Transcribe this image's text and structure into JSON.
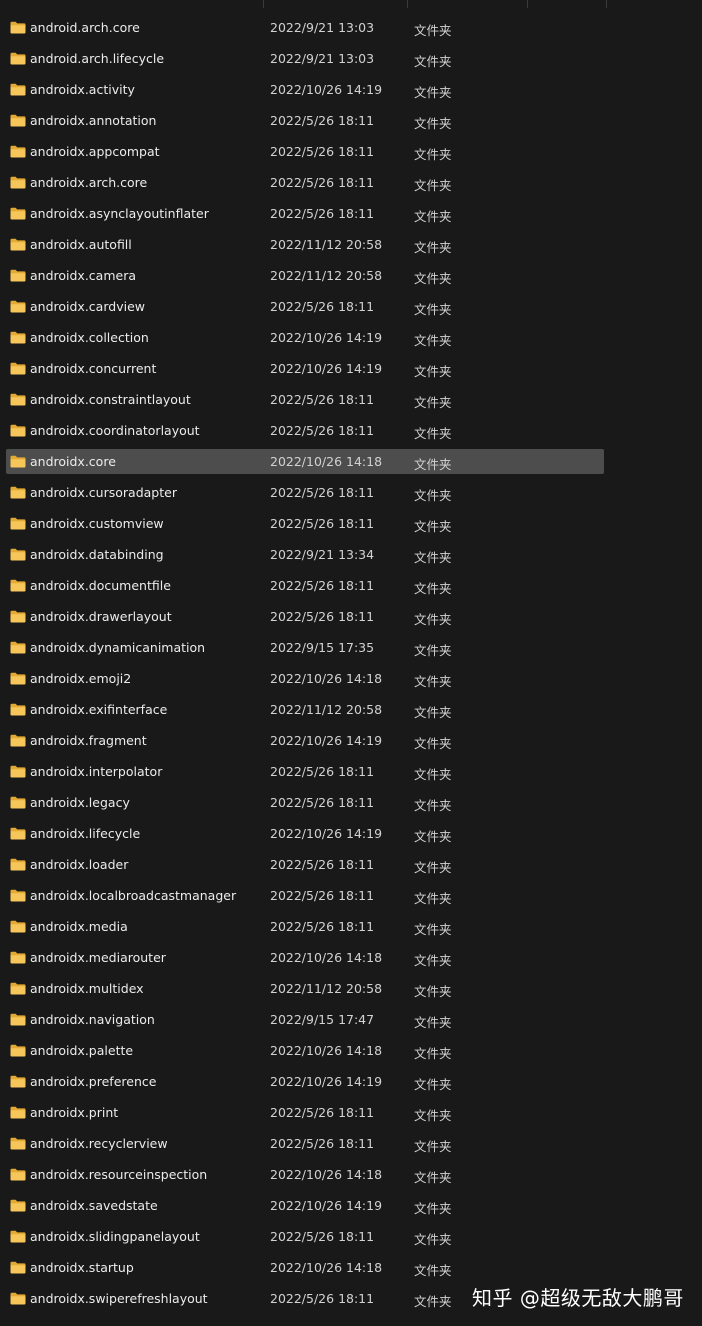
{
  "files": [
    {
      "name": "android.arch.core",
      "date": "2022/9/21 13:03",
      "type": "文件夹",
      "selected": false
    },
    {
      "name": "android.arch.lifecycle",
      "date": "2022/9/21 13:03",
      "type": "文件夹",
      "selected": false
    },
    {
      "name": "androidx.activity",
      "date": "2022/10/26 14:19",
      "type": "文件夹",
      "selected": false
    },
    {
      "name": "androidx.annotation",
      "date": "2022/5/26 18:11",
      "type": "文件夹",
      "selected": false
    },
    {
      "name": "androidx.appcompat",
      "date": "2022/5/26 18:11",
      "type": "文件夹",
      "selected": false
    },
    {
      "name": "androidx.arch.core",
      "date": "2022/5/26 18:11",
      "type": "文件夹",
      "selected": false
    },
    {
      "name": "androidx.asynclayoutinflater",
      "date": "2022/5/26 18:11",
      "type": "文件夹",
      "selected": false
    },
    {
      "name": "androidx.autofill",
      "date": "2022/11/12 20:58",
      "type": "文件夹",
      "selected": false
    },
    {
      "name": "androidx.camera",
      "date": "2022/11/12 20:58",
      "type": "文件夹",
      "selected": false
    },
    {
      "name": "androidx.cardview",
      "date": "2022/5/26 18:11",
      "type": "文件夹",
      "selected": false
    },
    {
      "name": "androidx.collection",
      "date": "2022/10/26 14:19",
      "type": "文件夹",
      "selected": false
    },
    {
      "name": "androidx.concurrent",
      "date": "2022/10/26 14:19",
      "type": "文件夹",
      "selected": false
    },
    {
      "name": "androidx.constraintlayout",
      "date": "2022/5/26 18:11",
      "type": "文件夹",
      "selected": false
    },
    {
      "name": "androidx.coordinatorlayout",
      "date": "2022/5/26 18:11",
      "type": "文件夹",
      "selected": false
    },
    {
      "name": "androidx.core",
      "date": "2022/10/26 14:18",
      "type": "文件夹",
      "selected": true
    },
    {
      "name": "androidx.cursoradapter",
      "date": "2022/5/26 18:11",
      "type": "文件夹",
      "selected": false
    },
    {
      "name": "androidx.customview",
      "date": "2022/5/26 18:11",
      "type": "文件夹",
      "selected": false
    },
    {
      "name": "androidx.databinding",
      "date": "2022/9/21 13:34",
      "type": "文件夹",
      "selected": false
    },
    {
      "name": "androidx.documentfile",
      "date": "2022/5/26 18:11",
      "type": "文件夹",
      "selected": false
    },
    {
      "name": "androidx.drawerlayout",
      "date": "2022/5/26 18:11",
      "type": "文件夹",
      "selected": false
    },
    {
      "name": "androidx.dynamicanimation",
      "date": "2022/9/15 17:35",
      "type": "文件夹",
      "selected": false
    },
    {
      "name": "androidx.emoji2",
      "date": "2022/10/26 14:18",
      "type": "文件夹",
      "selected": false
    },
    {
      "name": "androidx.exifinterface",
      "date": "2022/11/12 20:58",
      "type": "文件夹",
      "selected": false
    },
    {
      "name": "androidx.fragment",
      "date": "2022/10/26 14:19",
      "type": "文件夹",
      "selected": false
    },
    {
      "name": "androidx.interpolator",
      "date": "2022/5/26 18:11",
      "type": "文件夹",
      "selected": false
    },
    {
      "name": "androidx.legacy",
      "date": "2022/5/26 18:11",
      "type": "文件夹",
      "selected": false
    },
    {
      "name": "androidx.lifecycle",
      "date": "2022/10/26 14:19",
      "type": "文件夹",
      "selected": false
    },
    {
      "name": "androidx.loader",
      "date": "2022/5/26 18:11",
      "type": "文件夹",
      "selected": false
    },
    {
      "name": "androidx.localbroadcastmanager",
      "date": "2022/5/26 18:11",
      "type": "文件夹",
      "selected": false
    },
    {
      "name": "androidx.media",
      "date": "2022/5/26 18:11",
      "type": "文件夹",
      "selected": false
    },
    {
      "name": "androidx.mediarouter",
      "date": "2022/10/26 14:18",
      "type": "文件夹",
      "selected": false
    },
    {
      "name": "androidx.multidex",
      "date": "2022/11/12 20:58",
      "type": "文件夹",
      "selected": false
    },
    {
      "name": "androidx.navigation",
      "date": "2022/9/15 17:47",
      "type": "文件夹",
      "selected": false
    },
    {
      "name": "androidx.palette",
      "date": "2022/10/26 14:18",
      "type": "文件夹",
      "selected": false
    },
    {
      "name": "androidx.preference",
      "date": "2022/10/26 14:19",
      "type": "文件夹",
      "selected": false
    },
    {
      "name": "androidx.print",
      "date": "2022/5/26 18:11",
      "type": "文件夹",
      "selected": false
    },
    {
      "name": "androidx.recyclerview",
      "date": "2022/5/26 18:11",
      "type": "文件夹",
      "selected": false
    },
    {
      "name": "androidx.resourceinspection",
      "date": "2022/10/26 14:18",
      "type": "文件夹",
      "selected": false
    },
    {
      "name": "androidx.savedstate",
      "date": "2022/10/26 14:19",
      "type": "文件夹",
      "selected": false
    },
    {
      "name": "androidx.slidingpanelayout",
      "date": "2022/5/26 18:11",
      "type": "文件夹",
      "selected": false
    },
    {
      "name": "androidx.startup",
      "date": "2022/10/26 14:18",
      "type": "文件夹",
      "selected": false
    },
    {
      "name": "androidx.swiperefreshlayout",
      "date": "2022/5/26 18:11",
      "type": "文件夹",
      "selected": false
    }
  ],
  "icon": "folder-icon",
  "colors": {
    "background": "#191919",
    "selected_row": "#4d4d4d",
    "folder": "#f2c14e"
  },
  "watermark": "知乎 @超级无敌大鹏哥"
}
